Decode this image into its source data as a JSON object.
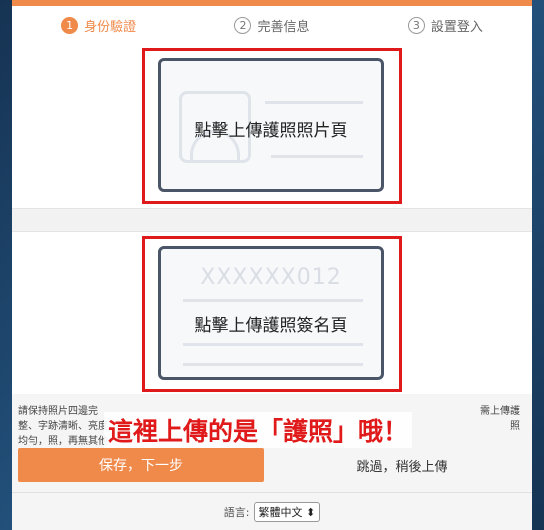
{
  "steps": [
    {
      "number": "1",
      "label": "身份驗證",
      "active": true
    },
    {
      "number": "2",
      "label": "完善信息",
      "active": false
    },
    {
      "number": "3",
      "label": "設置登入",
      "active": false
    }
  ],
  "upload": {
    "photo_page_label": "點擊上傳護照照片頁",
    "signature_page_label": "點擊上傳護照簽名頁",
    "signature_placeholder": "XXXXXX012"
  },
  "notes": {
    "left_text": "請保持照片四邊完整、字跡清晰、亮度均勻，照，再無其他證",
    "right_text": "需上傳護照"
  },
  "overlay_text": "這裡上傳的是「護照」哦！",
  "buttons": {
    "save": "保存，下一步",
    "skip": "跳過，稍後上傳"
  },
  "language": {
    "label": "語言:",
    "selected": "繁體中文"
  },
  "colors": {
    "accent": "#f08a4b",
    "highlight_red": "#e01a1a"
  }
}
